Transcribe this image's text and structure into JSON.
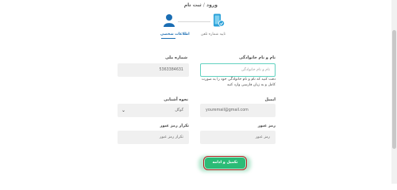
{
  "breadcrumb": {
    "home": "ورود",
    "separator": "/",
    "current": "ثبت نام"
  },
  "steps": [
    {
      "label": "تایید شماره تلفن",
      "icon": "phone-check-icon",
      "state": "done"
    },
    {
      "label": "اطلاعات شخصی",
      "icon": "user-icon",
      "state": "active"
    }
  ],
  "colors": {
    "accent": "#1a6db3",
    "step_done": "#2aa0d8",
    "submit": "#2bbb76",
    "focus": "#62d2c0"
  },
  "form": {
    "full_name": {
      "label": "نام و نام خانوادگی",
      "placeholder": "نام و نام خانوادگی"
    },
    "national_code": {
      "label": "شماره ملی",
      "value": "5363384631"
    },
    "hint": "دقت کنید که نام و نام خانوادگی خود را به صورت کامل و به زبان فارسی وارد کنید",
    "email": {
      "label": "ایمیل",
      "value": "youremail@gmail.com"
    },
    "education": {
      "label": "نحوه آشنایی",
      "value": "گوگل"
    },
    "password": {
      "label": "رمز عبور",
      "placeholder": "رمز عبور"
    },
    "password_repeat": {
      "label": "تکرار رمز عبور",
      "placeholder": "تکرار رمز عبور"
    },
    "submit_label": "تکمیل و ادامه"
  }
}
